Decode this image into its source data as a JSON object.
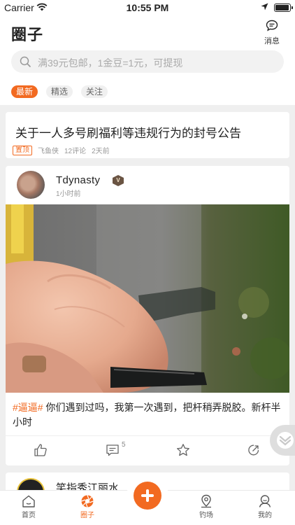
{
  "status_bar": {
    "carrier": "Carrier",
    "time": "10:55 PM"
  },
  "header": {
    "title": "圈子",
    "messages_label": "消息"
  },
  "search": {
    "placeholder": "满39元包邮，1金豆=1元，可提现"
  },
  "tabs": [
    {
      "label": "最新",
      "active": true
    },
    {
      "label": "精选",
      "active": false
    },
    {
      "label": "关注",
      "active": false
    }
  ],
  "announcement": {
    "title": "关于一人多号刷福利等违规行为的封号公告",
    "pin_label": "置顶",
    "author": "飞鱼侠",
    "comments": "12评论",
    "time": "2天前"
  },
  "post": {
    "username": "Tdynasty",
    "badge_text": "V",
    "time": "1小时前",
    "hashtag": "#逼逼#",
    "text": " 你们遇到过吗，我第一次遇到，把杆稍弄脱胶。新杆半小时",
    "comment_count": "5"
  },
  "next_post": {
    "username": "笑指秀江丽水"
  },
  "tabbar": [
    {
      "label": "首页",
      "icon": "home-icon",
      "active": false
    },
    {
      "label": "圈子",
      "icon": "aperture-icon",
      "active": true
    },
    {
      "label": "钓场",
      "icon": "location-pin-icon",
      "active": false
    },
    {
      "label": "我的",
      "icon": "user-icon",
      "active": false
    }
  ],
  "colors": {
    "accent": "#f26a21"
  }
}
